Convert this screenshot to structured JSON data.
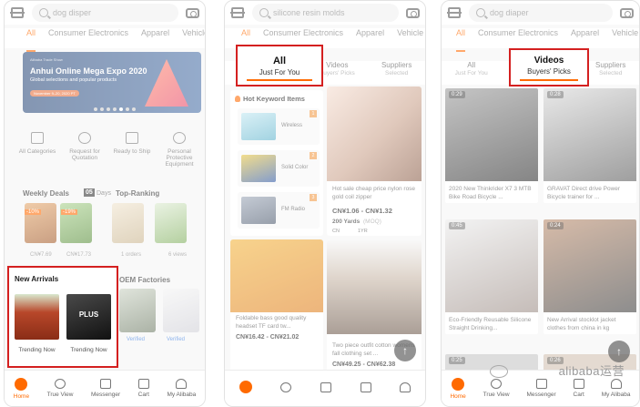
{
  "colors": {
    "accent": "#ff6a00",
    "highlight_border": "#d42020"
  },
  "screens": [
    {
      "search_placeholder": "dog disper",
      "categories": [
        "All",
        "Consumer Electronics",
        "Apparel",
        "Vehicle"
      ],
      "banner": {
        "small": "Alibaba Trade Show",
        "title": "Anhui Online Mega Expo 2020",
        "subtitle": "Global selections and popular products",
        "date": "November 9–20, 2020 PT"
      },
      "quick": [
        "All Categories",
        "Request for Quotation",
        "Ready to Ship",
        "Personal Protective Equipment"
      ],
      "weekly_deals": "Weekly Deals",
      "days": "Days",
      "days_count": "05",
      "top_ranking": "Top-Ranking",
      "discounts": [
        "-10%",
        "-19%"
      ],
      "prices": [
        "CN¥7.69",
        "CN¥17.73"
      ],
      "ranking_meta": [
        "1 orders",
        "6 views"
      ],
      "oem": "OEM Factories",
      "verified": [
        "Verified",
        "Verified"
      ],
      "new_arrivals": {
        "title": "New Arrivals",
        "labels": [
          "Trending Now",
          "Trending Now"
        ],
        "bag_text": "PLUS"
      },
      "nav": [
        "Home",
        "True View",
        "Messenger",
        "Cart",
        "My Alibaba"
      ]
    },
    {
      "search_placeholder": "silicone resin molds",
      "categories": [
        "All",
        "Consumer Electronics",
        "Apparel",
        "Vehicle"
      ],
      "highlight": {
        "title": "All",
        "subtitle": "Just For You"
      },
      "tabs": [
        {
          "title": "Videos",
          "sub": "Buyers' Picks"
        },
        {
          "title": "Suppliers",
          "sub": "Selected"
        }
      ],
      "hot_keywords": {
        "title": "Hot Keyword Items",
        "items": [
          "Wireless",
          "Solid Color",
          "FM Radio"
        ],
        "badges": [
          "1",
          "2",
          "3"
        ]
      },
      "product1": {
        "desc": "Hot sale cheap price nylon rose gold coil zipper",
        "price": "CN¥1.06 - CN¥1.32",
        "moq": "200 Yards",
        "moq_label": "(MOQ)",
        "country": "CN",
        "years": "1YR"
      },
      "product2": {
        "desc": "Foldable bass good quality headset TF card tw...",
        "price": "CN¥16.42 - CN¥21.02"
      },
      "product3": {
        "desc": "Two piece outfit cotton womens fall clothing set ...",
        "price": "CN¥49.25 - CN¥62.38"
      },
      "float_icon": "arrow-up-icon"
    },
    {
      "search_placeholder": "dog diaper",
      "categories": [
        "All",
        "Consumer Electronics",
        "Apparel",
        "Vehicle"
      ],
      "tabs": [
        {
          "title": "All",
          "sub": "Just For You"
        },
        {
          "title": "Suppliers",
          "sub": "Selected"
        }
      ],
      "highlight": {
        "title": "Videos",
        "subtitle": "Buyers' Picks"
      },
      "videos": [
        {
          "dur": "0:29",
          "caption": "2020 New Thinkrider X7 3 MTB Bike Road Bicycle ..."
        },
        {
          "dur": "0:28",
          "caption": "GRAVAT Direct drive Power Bicycle trainer for ..."
        },
        {
          "dur": "0:45",
          "caption": "Eco-Friendly Reusable Silicone Straight Drinking..."
        },
        {
          "dur": "0:24",
          "caption": "New Arrival stocklot jacket clothes from china in kg"
        },
        {
          "dur": "0:25",
          "caption": ""
        },
        {
          "dur": "0:26",
          "caption": ""
        }
      ],
      "nav": [
        "Home",
        "True View",
        "Messenger",
        "Cart",
        "My Alibaba"
      ],
      "watermark": "alibaba运营"
    }
  ]
}
